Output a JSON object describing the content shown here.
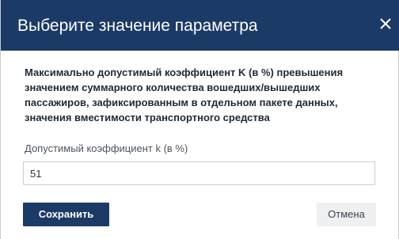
{
  "dialog": {
    "title": "Выберите значение параметра",
    "close_icon": "close-icon",
    "description": "Максимально допустимый коэффициент K (в %) превышения значением суммарного количества вошедших/вышедших пассажиров, зафиксированным в отдельном пакете данных, значения вместимости транспортного средства",
    "field": {
      "label": "Допустимый коэффициент k (в %)",
      "value": "51"
    },
    "buttons": {
      "save_label": "Сохранить",
      "cancel_label": "Отмена"
    }
  },
  "colors": {
    "header_bg": "#1c3a66",
    "primary_button": "#1c3a66",
    "secondary_button": "#eef0f2"
  }
}
